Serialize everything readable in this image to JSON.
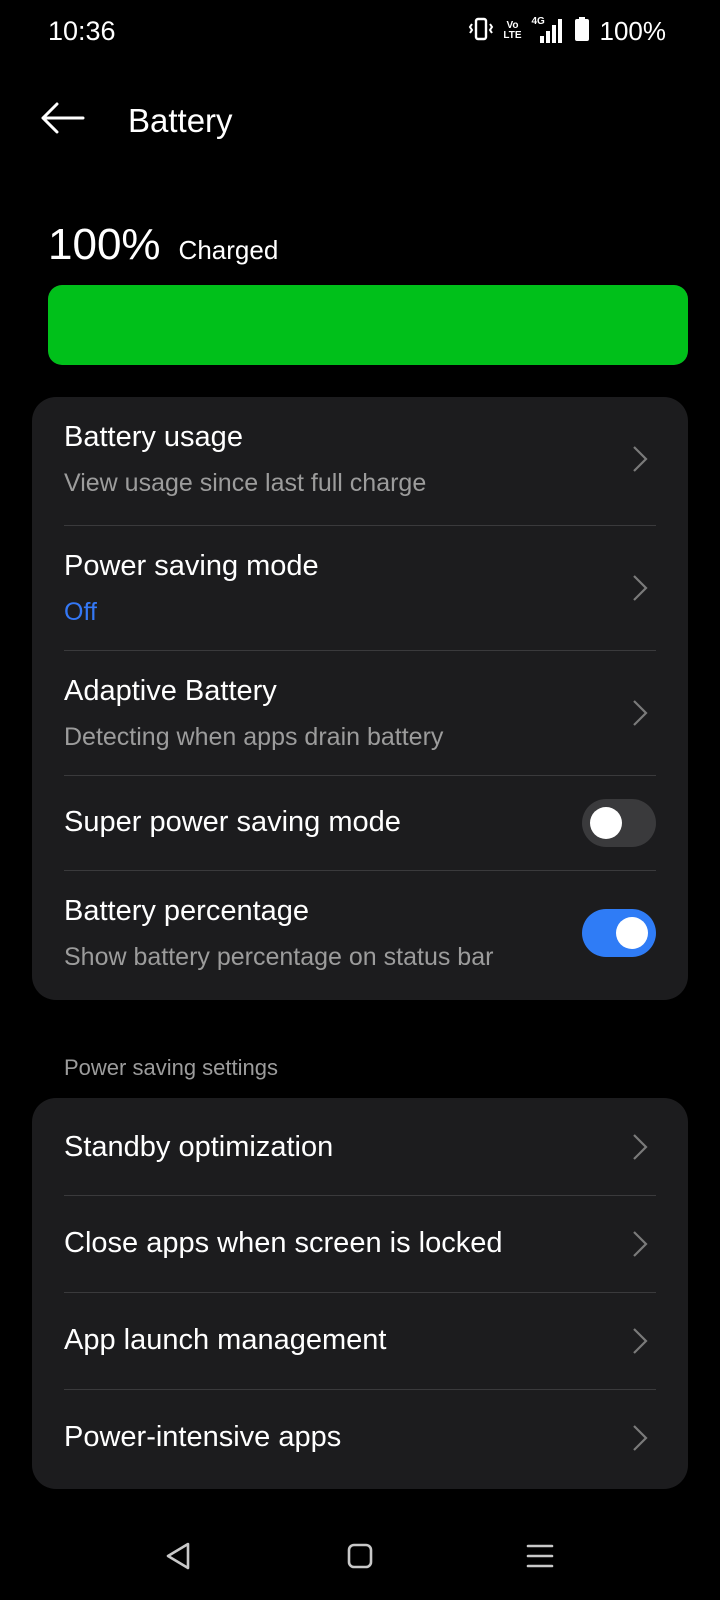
{
  "status_bar": {
    "time": "10:36",
    "volte_top": "Vo",
    "volte_bottom": "LTE",
    "network": "4G",
    "battery_percent": "100%"
  },
  "header": {
    "title": "Battery",
    "back_icon": "back-arrow-icon"
  },
  "battery_level": {
    "value": "100%",
    "state": "Charged",
    "fraction": 1.0,
    "bar_color": "#00c01a"
  },
  "main_settings": [
    {
      "title": "Battery usage",
      "subtitle": "View usage since last full charge",
      "control": "chevron"
    },
    {
      "title": "Power saving mode",
      "subtitle": "Off",
      "subtitle_color": "#3478f6",
      "control": "chevron"
    },
    {
      "title": "Adaptive Battery",
      "subtitle": "Detecting when apps drain battery",
      "control": "chevron"
    },
    {
      "title": "Super power saving mode",
      "control": "toggle",
      "toggle_on": false
    },
    {
      "title": "Battery percentage",
      "subtitle": "Show battery percentage on status bar",
      "control": "toggle",
      "toggle_on": true
    }
  ],
  "power_saving_settings": {
    "header": "Power saving settings",
    "items": [
      {
        "title": "Standby optimization"
      },
      {
        "title": "Close apps when screen is locked"
      },
      {
        "title": "App launch management"
      },
      {
        "title": "Power-intensive apps"
      }
    ]
  },
  "navigation_bar": {
    "back_icon": "triangle-back-icon",
    "home_icon": "square-home-icon",
    "recents_icon": "menu-recents-icon"
  },
  "colors": {
    "background": "#000000",
    "card": "#1c1c1e",
    "accent": "#2f7cf6",
    "battery_green": "#00c01a"
  }
}
